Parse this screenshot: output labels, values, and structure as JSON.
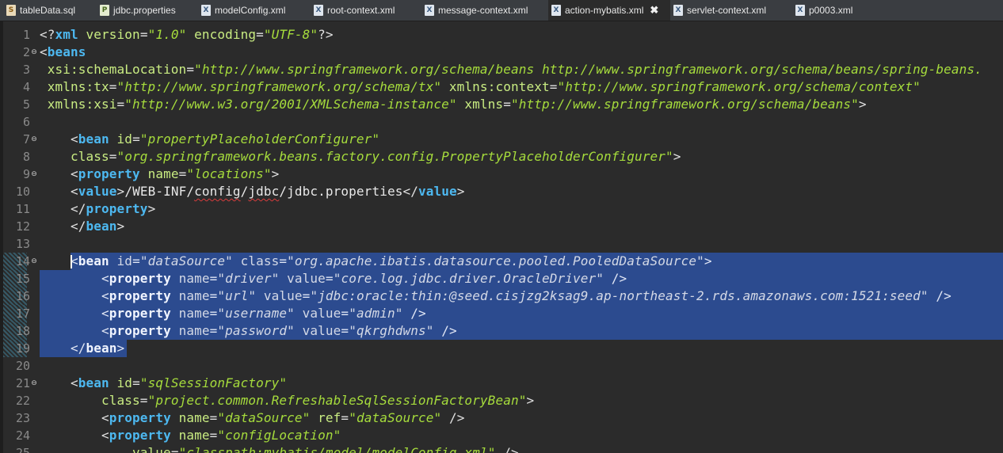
{
  "tabs": [
    {
      "label": "tableData.sql",
      "icon": "sql-file-icon",
      "active": false
    },
    {
      "label": "jdbc.properties",
      "icon": "properties-file-icon",
      "active": false
    },
    {
      "label": "modelConfig.xml",
      "icon": "xml-file-icon",
      "active": false
    },
    {
      "label": "root-context.xml",
      "icon": "xml-file-icon",
      "active": false
    },
    {
      "label": "message-context.xml",
      "icon": "xml-file-icon",
      "active": false
    },
    {
      "label": "action-mybatis.xml",
      "icon": "xml-file-icon",
      "active": true
    },
    {
      "label": "servlet-context.xml",
      "icon": "xml-file-icon",
      "active": false
    },
    {
      "label": "p0003.xml",
      "icon": "xml-file-icon",
      "active": false
    }
  ],
  "close_glyph": "✖",
  "colors": {
    "background": "#2b2b2b",
    "tag": "#4db8f0",
    "attribute": "#c9ec82",
    "value": "#a6dc3c",
    "selection": "#2c4b8f"
  },
  "editor": {
    "lines": [
      {
        "num": "1",
        "fold": false,
        "selected": false,
        "tokens": [
          {
            "t": "br",
            "v": "<?"
          },
          {
            "t": "tag",
            "v": "xml"
          },
          {
            "t": "attr",
            "v": " version"
          },
          {
            "t": "br",
            "v": "="
          },
          {
            "t": "val",
            "v": "\"1.0\""
          },
          {
            "t": "attr",
            "v": " encoding"
          },
          {
            "t": "br",
            "v": "="
          },
          {
            "t": "val",
            "v": "\"UTF-8\""
          },
          {
            "t": "br",
            "v": "?>"
          }
        ]
      },
      {
        "num": "2",
        "fold": true,
        "selected": false,
        "tokens": [
          {
            "t": "br",
            "v": "<"
          },
          {
            "t": "tag",
            "v": "beans"
          }
        ]
      },
      {
        "num": "3",
        "fold": false,
        "selected": false,
        "tokens": [
          {
            "t": "attr",
            "v": " xsi:schemaLocation"
          },
          {
            "t": "br",
            "v": "="
          },
          {
            "t": "val",
            "v": "\"http://www.springframework.org/schema/beans http://www.springframework.org/schema/beans/spring-beans."
          }
        ]
      },
      {
        "num": "4",
        "fold": false,
        "selected": false,
        "tokens": [
          {
            "t": "attr",
            "v": " xmlns:tx"
          },
          {
            "t": "br",
            "v": "="
          },
          {
            "t": "val",
            "v": "\"http://www.springframework.org/schema/tx\""
          },
          {
            "t": "attr",
            "v": " xmlns:context"
          },
          {
            "t": "br",
            "v": "="
          },
          {
            "t": "val",
            "v": "\"http://www.springframework.org/schema/context\""
          }
        ]
      },
      {
        "num": "5",
        "fold": false,
        "selected": false,
        "tokens": [
          {
            "t": "attr",
            "v": " xmlns:xsi"
          },
          {
            "t": "br",
            "v": "="
          },
          {
            "t": "val",
            "v": "\"http://www.w3.org/2001/XMLSchema-instance\""
          },
          {
            "t": "attr",
            "v": " xmlns"
          },
          {
            "t": "br",
            "v": "="
          },
          {
            "t": "val",
            "v": "\"http://www.springframework.org/schema/beans\""
          },
          {
            "t": "br",
            "v": ">"
          }
        ]
      },
      {
        "num": "6",
        "fold": false,
        "selected": false,
        "tokens": []
      },
      {
        "num": "7",
        "fold": true,
        "selected": false,
        "tokens": [
          {
            "t": "text",
            "v": "    "
          },
          {
            "t": "br",
            "v": "<"
          },
          {
            "t": "tag",
            "v": "bean"
          },
          {
            "t": "attr",
            "v": " id"
          },
          {
            "t": "br",
            "v": "="
          },
          {
            "t": "val",
            "v": "\"propertyPlaceholderConfigurer\""
          }
        ]
      },
      {
        "num": "8",
        "fold": false,
        "selected": false,
        "tokens": [
          {
            "t": "attr",
            "v": "    class"
          },
          {
            "t": "br",
            "v": "="
          },
          {
            "t": "val",
            "v": "\"org.springframework.beans.factory.config.PropertyPlaceholderConfigurer\""
          },
          {
            "t": "br",
            "v": ">"
          }
        ]
      },
      {
        "num": "9",
        "fold": true,
        "selected": false,
        "tokens": [
          {
            "t": "text",
            "v": "    "
          },
          {
            "t": "br",
            "v": "<"
          },
          {
            "t": "tag",
            "v": "property"
          },
          {
            "t": "attr",
            "v": " name"
          },
          {
            "t": "br",
            "v": "="
          },
          {
            "t": "val",
            "v": "\"locations\""
          },
          {
            "t": "br",
            "v": ">"
          }
        ]
      },
      {
        "num": "10",
        "fold": false,
        "selected": false,
        "tokens": [
          {
            "t": "text",
            "v": "    "
          },
          {
            "t": "br",
            "v": "<"
          },
          {
            "t": "tag",
            "v": "value"
          },
          {
            "t": "br",
            "v": ">"
          },
          {
            "t": "text",
            "v": "/WEB-INF/"
          },
          {
            "t": "squig",
            "v": "config"
          },
          {
            "t": "text",
            "v": "/"
          },
          {
            "t": "squig",
            "v": "jdbc"
          },
          {
            "t": "text",
            "v": "/jdbc.properties"
          },
          {
            "t": "br",
            "v": "</"
          },
          {
            "t": "tag",
            "v": "value"
          },
          {
            "t": "br",
            "v": ">"
          }
        ]
      },
      {
        "num": "11",
        "fold": false,
        "selected": false,
        "tokens": [
          {
            "t": "text",
            "v": "    "
          },
          {
            "t": "br",
            "v": "</"
          },
          {
            "t": "tag",
            "v": "property"
          },
          {
            "t": "br",
            "v": ">"
          }
        ]
      },
      {
        "num": "12",
        "fold": false,
        "selected": false,
        "tokens": [
          {
            "t": "text",
            "v": "    "
          },
          {
            "t": "br",
            "v": "</"
          },
          {
            "t": "tag",
            "v": "bean"
          },
          {
            "t": "br",
            "v": ">"
          }
        ]
      },
      {
        "num": "13",
        "fold": false,
        "selected": false,
        "tokens": []
      },
      {
        "num": "14",
        "fold": true,
        "selected": "partial",
        "tokens": [
          {
            "t": "text",
            "v": "    "
          },
          {
            "t": "br",
            "v": "<"
          },
          {
            "t": "tag",
            "v": "bean"
          },
          {
            "t": "attr",
            "v": " id"
          },
          {
            "t": "br",
            "v": "="
          },
          {
            "t": "val",
            "v": "\"dataSource\""
          },
          {
            "t": "attr",
            "v": " class"
          },
          {
            "t": "br",
            "v": "="
          },
          {
            "t": "val",
            "v": "\"org.apache.ibatis.datasource.pooled.PooledDataSource\""
          },
          {
            "t": "br",
            "v": ">"
          }
        ]
      },
      {
        "num": "15",
        "fold": false,
        "selected": "full",
        "tokens": [
          {
            "t": "text",
            "v": "        "
          },
          {
            "t": "br",
            "v": "<"
          },
          {
            "t": "tag",
            "v": "property"
          },
          {
            "t": "attr",
            "v": " name"
          },
          {
            "t": "br",
            "v": "="
          },
          {
            "t": "val",
            "v": "\"driver\""
          },
          {
            "t": "attr",
            "v": " value"
          },
          {
            "t": "br",
            "v": "="
          },
          {
            "t": "val",
            "v": "\"core.log.jdbc.driver.OracleDriver\""
          },
          {
            "t": "br",
            "v": " />"
          }
        ]
      },
      {
        "num": "16",
        "fold": false,
        "selected": "full",
        "tokens": [
          {
            "t": "text",
            "v": "        "
          },
          {
            "t": "br",
            "v": "<"
          },
          {
            "t": "tag",
            "v": "property"
          },
          {
            "t": "attr",
            "v": " name"
          },
          {
            "t": "br",
            "v": "="
          },
          {
            "t": "val",
            "v": "\"url\""
          },
          {
            "t": "attr",
            "v": " value"
          },
          {
            "t": "br",
            "v": "="
          },
          {
            "t": "val",
            "v": "\"jdbc:oracle:thin:@seed.cisjzg2ksag9.ap-northeast-2.rds.amazonaws.com:1521:seed\""
          },
          {
            "t": "br",
            "v": " />"
          }
        ]
      },
      {
        "num": "17",
        "fold": false,
        "selected": "full",
        "tokens": [
          {
            "t": "text",
            "v": "        "
          },
          {
            "t": "br",
            "v": "<"
          },
          {
            "t": "tag",
            "v": "property"
          },
          {
            "t": "attr",
            "v": " name"
          },
          {
            "t": "br",
            "v": "="
          },
          {
            "t": "val",
            "v": "\"username\""
          },
          {
            "t": "attr",
            "v": " value"
          },
          {
            "t": "br",
            "v": "="
          },
          {
            "t": "val",
            "v": "\"admin\""
          },
          {
            "t": "br",
            "v": " />"
          }
        ]
      },
      {
        "num": "18",
        "fold": false,
        "selected": "full",
        "tokens": [
          {
            "t": "text",
            "v": "        "
          },
          {
            "t": "br",
            "v": "<"
          },
          {
            "t": "tag",
            "v": "property"
          },
          {
            "t": "attr",
            "v": " name"
          },
          {
            "t": "br",
            "v": "="
          },
          {
            "t": "val",
            "v": "\"password\""
          },
          {
            "t": "attr",
            "v": " value"
          },
          {
            "t": "br",
            "v": "="
          },
          {
            "t": "val",
            "v": "\"qkrghdwns\""
          },
          {
            "t": "br",
            "v": " />"
          }
        ]
      },
      {
        "num": "19",
        "fold": false,
        "selected": "end",
        "tokens": [
          {
            "t": "text",
            "v": "    "
          },
          {
            "t": "br",
            "v": "</"
          },
          {
            "t": "tag",
            "v": "bean"
          },
          {
            "t": "br",
            "v": ">"
          }
        ]
      },
      {
        "num": "20",
        "fold": false,
        "selected": false,
        "tokens": []
      },
      {
        "num": "21",
        "fold": true,
        "selected": false,
        "tokens": [
          {
            "t": "text",
            "v": "    "
          },
          {
            "t": "br",
            "v": "<"
          },
          {
            "t": "tag",
            "v": "bean"
          },
          {
            "t": "attr",
            "v": " id"
          },
          {
            "t": "br",
            "v": "="
          },
          {
            "t": "val",
            "v": "\"sqlSessionFactory\""
          }
        ]
      },
      {
        "num": "22",
        "fold": false,
        "selected": false,
        "tokens": [
          {
            "t": "attr",
            "v": "        class"
          },
          {
            "t": "br",
            "v": "="
          },
          {
            "t": "val",
            "v": "\"project.common.RefreshableSqlSessionFactoryBean\""
          },
          {
            "t": "br",
            "v": ">"
          }
        ]
      },
      {
        "num": "23",
        "fold": false,
        "selected": false,
        "tokens": [
          {
            "t": "text",
            "v": "        "
          },
          {
            "t": "br",
            "v": "<"
          },
          {
            "t": "tag",
            "v": "property"
          },
          {
            "t": "attr",
            "v": " name"
          },
          {
            "t": "br",
            "v": "="
          },
          {
            "t": "val",
            "v": "\"dataSource\""
          },
          {
            "t": "attr",
            "v": " ref"
          },
          {
            "t": "br",
            "v": "="
          },
          {
            "t": "val",
            "v": "\"dataSource\""
          },
          {
            "t": "br",
            "v": " />"
          }
        ]
      },
      {
        "num": "24",
        "fold": false,
        "selected": false,
        "tokens": [
          {
            "t": "text",
            "v": "        "
          },
          {
            "t": "br",
            "v": "<"
          },
          {
            "t": "tag",
            "v": "property"
          },
          {
            "t": "attr",
            "v": " name"
          },
          {
            "t": "br",
            "v": "="
          },
          {
            "t": "val",
            "v": "\"configLocation\""
          }
        ]
      },
      {
        "num": "25",
        "fold": false,
        "selected": false,
        "tokens": [
          {
            "t": "attr",
            "v": "            value"
          },
          {
            "t": "br",
            "v": "="
          },
          {
            "t": "val",
            "v": "\"classpath:mybatis/model/modelConfig.xml\""
          },
          {
            "t": "br",
            "v": " />"
          }
        ]
      }
    ]
  }
}
